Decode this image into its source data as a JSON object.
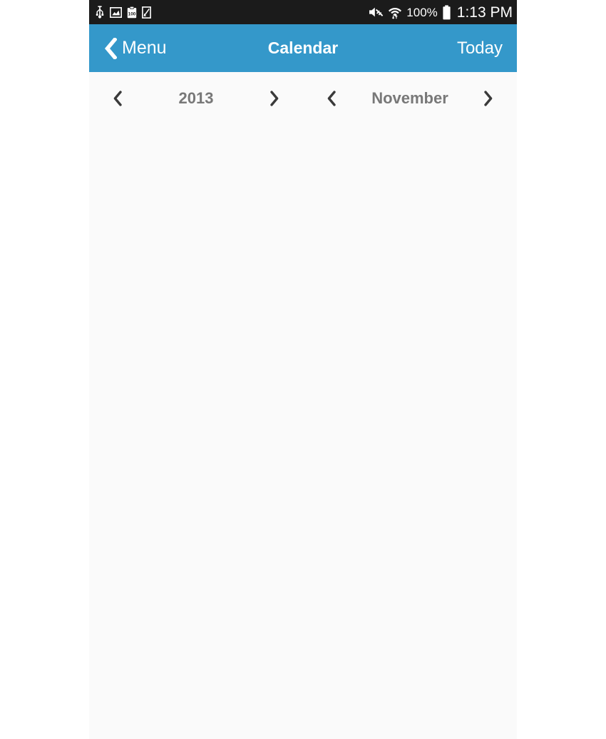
{
  "statusbar": {
    "left_icons": [
      {
        "name": "usb-icon",
        "label": "USB"
      },
      {
        "name": "screenshot-image-icon",
        "label": "Screenshot"
      },
      {
        "name": "clipboard-100-icon",
        "label": "100"
      },
      {
        "name": "document-note-icon",
        "label": "Note"
      }
    ],
    "right_icons": [
      {
        "name": "mute-volume-off-icon",
        "label": "Muted"
      },
      {
        "name": "wifi-data-icon",
        "label": "Wi-Fi"
      }
    ],
    "battery_percent": "100%",
    "battery_icon": "battery-full-icon",
    "clock": "1:13 PM"
  },
  "navbar": {
    "back_icon": "chevron-left-icon",
    "back_label": "Menu",
    "title": "Calendar",
    "action_label": "Today",
    "background_color": "#3498ca",
    "text_color": "#ffffff"
  },
  "selectors": {
    "year": {
      "prev_icon": "chevron-left-icon",
      "next_icon": "chevron-right-icon",
      "value": "2013"
    },
    "month": {
      "prev_icon": "chevron-left-icon",
      "next_icon": "chevron-right-icon",
      "value": "November"
    },
    "value_color": "#787878",
    "arrow_color": "#3a3a3a"
  },
  "calendar": {
    "days": [],
    "background_color": "#fafafa"
  }
}
